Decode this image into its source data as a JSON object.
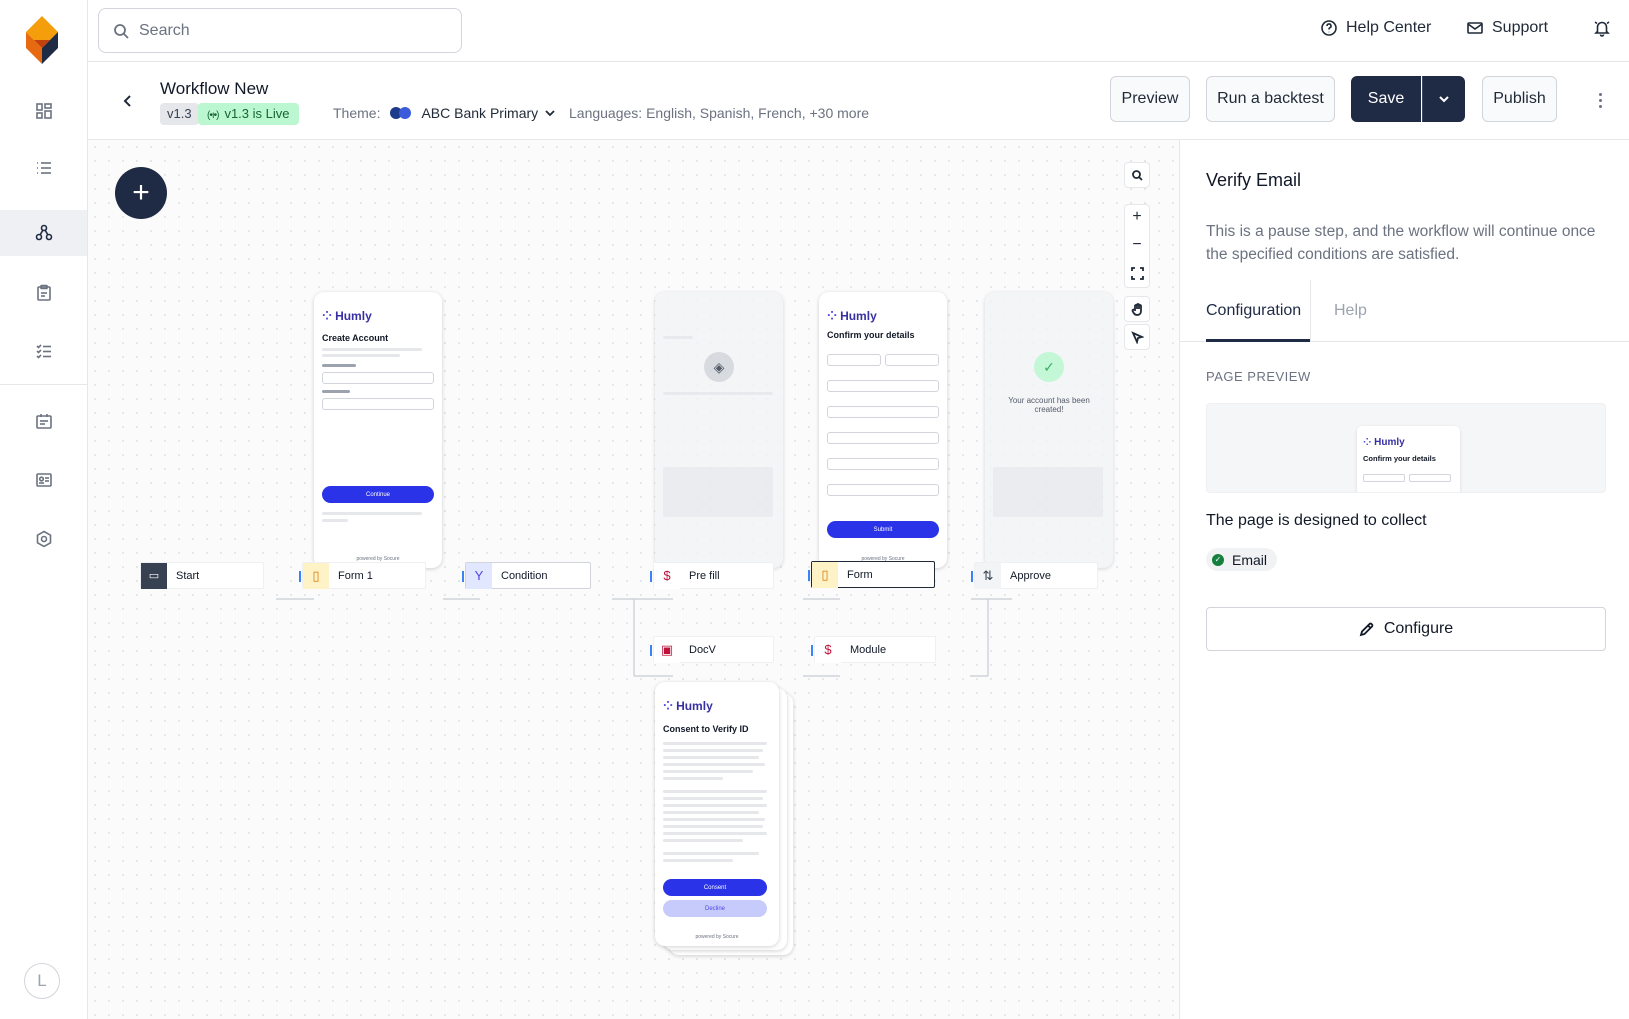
{
  "topbar": {
    "search_placeholder": "Search",
    "help_label": "Help Center",
    "support_label": "Support"
  },
  "header": {
    "title": "Workflow New",
    "version": "v1.3",
    "live_status": "v1.3 is Live",
    "theme_label": "Theme:",
    "theme_value": "ABC Bank Primary",
    "theme_colors": [
      "#1e3a8a",
      "#3b5bdb"
    ],
    "languages": "Languages: English, Spanish, French, +30 more",
    "buttons": {
      "preview": "Preview",
      "backtest": "Run a backtest",
      "save": "Save",
      "publish": "Publish"
    }
  },
  "sidebar": {
    "avatar_initial": "L",
    "items": [
      {
        "icon": "dashboard-icon",
        "active": false
      },
      {
        "icon": "list-icon",
        "active": false
      },
      {
        "icon": "workflow-icon",
        "active": true
      },
      {
        "icon": "clipboard-icon",
        "active": false
      },
      {
        "icon": "checklist-icon",
        "active": false
      },
      {
        "icon": "calendar-badge-icon",
        "active": false
      },
      {
        "icon": "id-card-icon",
        "active": false
      },
      {
        "icon": "hexagon-settings-icon",
        "active": false
      }
    ]
  },
  "canvas": {
    "nodes": {
      "start": "Start",
      "form1": "Form 1",
      "condition": "Condition",
      "prefill": "Pre fill",
      "form": "Form",
      "approve": "Approve",
      "docv": "DocV",
      "module": "Module"
    },
    "brand": "Humly",
    "form1_title": "Create Account",
    "form1_button": "Continue",
    "form_title": "Confirm your details",
    "form_button": "Submit",
    "approve_text": "Your account has been created!",
    "docv_title": "Consent to Verify ID",
    "docv_consent": "Consent",
    "docv_decline": "Decline",
    "powered_by": "powered by Socure",
    "accent_color": "#2a33e8"
  },
  "panel": {
    "title": "Verify Email",
    "description": "This is a pause step, and the workflow will continue once the specified conditions are satisfied.",
    "tabs": [
      "Configuration",
      "Help"
    ],
    "section_label": "PAGE PREVIEW",
    "preview_brand": "Humly",
    "preview_title": "Confirm your details",
    "collect_text": "The page is designed to collect",
    "chip": "Email",
    "configure_label": "Configure"
  }
}
